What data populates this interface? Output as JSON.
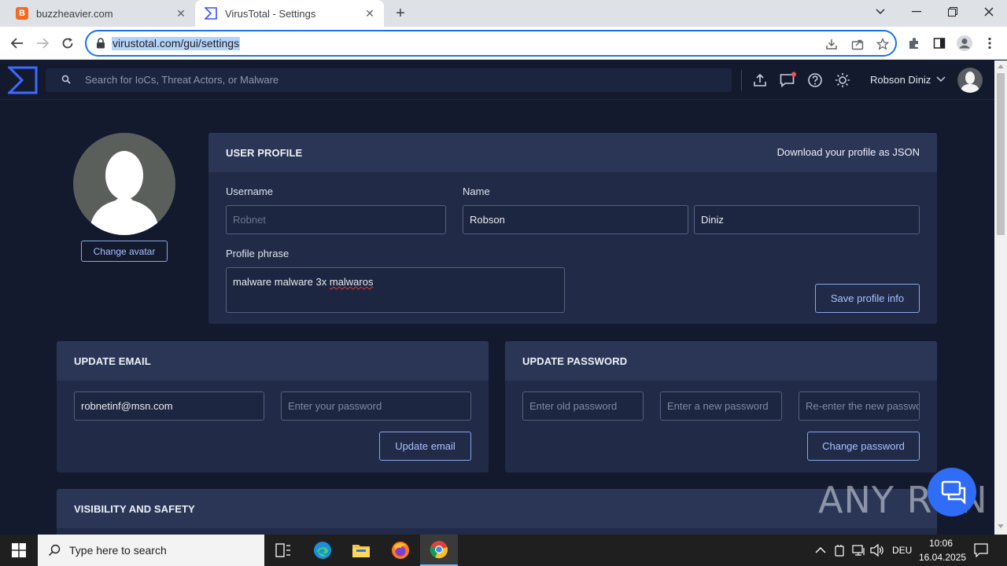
{
  "browser": {
    "tabs": [
      {
        "title": "buzzheavier.com",
        "favicon": "B"
      },
      {
        "title": "VirusTotal - Settings"
      }
    ],
    "url": "virustotal.com/gui/settings"
  },
  "header": {
    "search_placeholder": "Search for IoCs, Threat Actors, or Malware",
    "user_name": "Robson Diniz"
  },
  "avatar": {
    "change_label": "Change avatar"
  },
  "user_profile": {
    "title": "USER PROFILE",
    "download_label": "Download your profile as JSON",
    "username_label": "Username",
    "username_value": "Robnet",
    "name_label": "Name",
    "first_name": "Robson",
    "last_name": "Diniz",
    "phrase_label": "Profile phrase",
    "phrase_prefix": "malware malware 3x ",
    "phrase_misspelled": "malwaros",
    "save_label": "Save profile info"
  },
  "update_email": {
    "title": "UPDATE EMAIL",
    "email_value": "robnetinf@msn.com",
    "password_placeholder": "Enter your password",
    "button_label": "Update email"
  },
  "update_password": {
    "title": "UPDATE PASSWORD",
    "old_placeholder": "Enter old password",
    "new_placeholder": "Enter a new password",
    "reenter_placeholder": "Re-enter the new password",
    "button_label": "Change password"
  },
  "visibility": {
    "title": "VISIBILITY AND SAFETY"
  },
  "watermark": "ANY RUN",
  "taskbar": {
    "search_text": "Type here to search",
    "language": "DEU",
    "time": "10:06",
    "date": "16.04.2025"
  },
  "colors": {
    "page_bg": "#131a2e",
    "card_bg": "#212b47",
    "card_head_bg": "#2b3657",
    "accent": "#8ba5e8",
    "chat_fab": "#2f6df6"
  }
}
